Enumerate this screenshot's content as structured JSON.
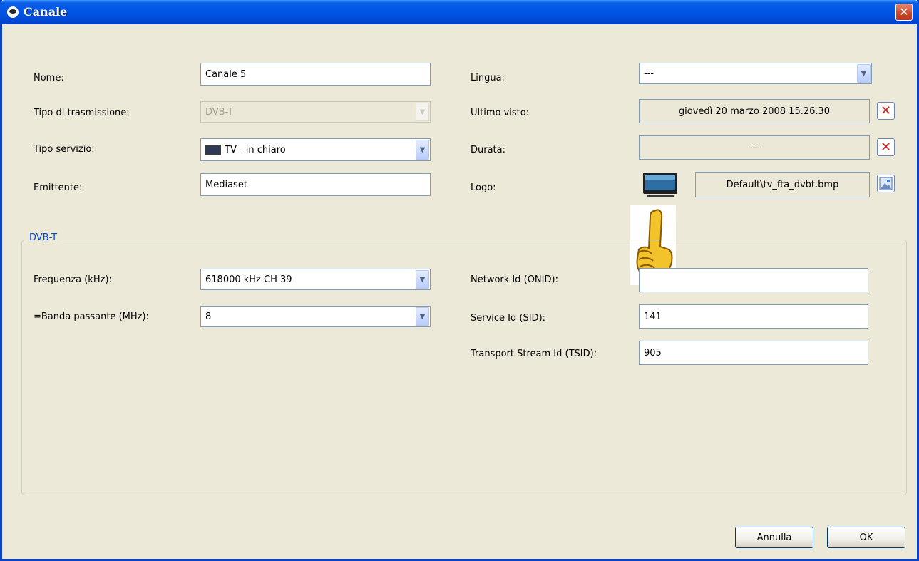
{
  "window": {
    "title": "Canale",
    "close_glyph": "✕"
  },
  "form": {
    "nome_label": "Nome:",
    "nome_value": "Canale 5",
    "tipo_trasmissione_label": "Tipo di trasmissione:",
    "tipo_trasmissione_value": "DVB-T",
    "tipo_servizio_label": "Tipo servizio:",
    "tipo_servizio_value": "TV - in chiaro",
    "emittente_label": "Emittente:",
    "emittente_value": "Mediaset",
    "lingua_label": "Lingua:",
    "lingua_value": "---",
    "ultimo_visto_label": "Ultimo visto:",
    "ultimo_visto_value": "giovedì 20 marzo 2008 15.26.30",
    "durata_label": "Durata:",
    "durata_value": "---",
    "logo_label": "Logo:",
    "logo_path": "Default\\tv_fta_dvbt.bmp"
  },
  "group": {
    "title": "DVB-T",
    "frequenza_label": "Frequenza (kHz):",
    "frequenza_value": "618000 kHz CH 39",
    "banda_label": "=Banda passante (MHz):",
    "banda_value": "8",
    "onid_label": "Network Id (ONID):",
    "onid_value": "",
    "sid_label": "Service Id (SID):",
    "sid_value": "141",
    "tsid_label": "Transport Stream Id (TSID):",
    "tsid_value": "905"
  },
  "buttons": {
    "cancel": "Annulla",
    "ok": "OK"
  },
  "icons": {
    "app": "app-icon",
    "clear": "red-x-icon",
    "browse": "image-browse-icon",
    "tv": "tv-icon",
    "pointer": "pointing-hand-icon",
    "dropdown": "chevron-down-icon"
  },
  "colors": {
    "titlebar": "#0055e5",
    "dialog_bg": "#ece9d8",
    "group_title": "#0046d5",
    "clear_x": "#d01c1c"
  }
}
